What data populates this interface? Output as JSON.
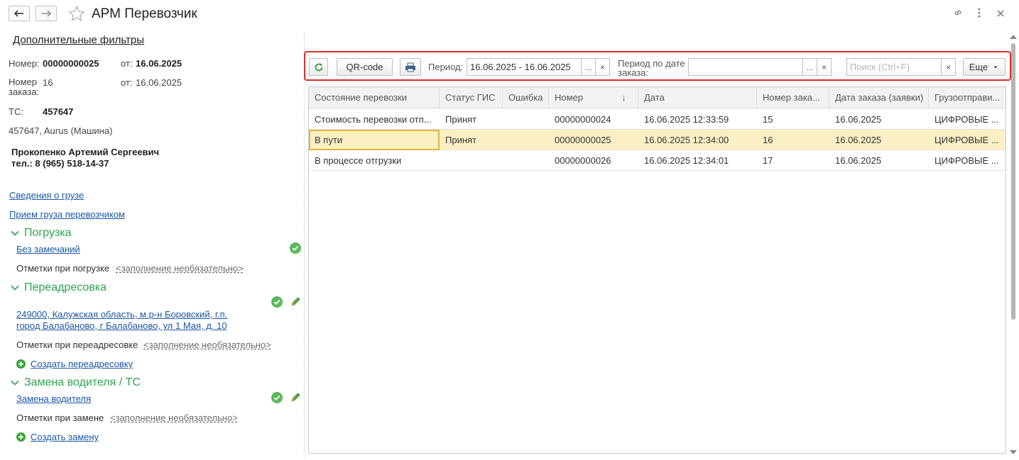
{
  "window": {
    "title": "АРМ Перевозчик",
    "back_icon": "arrow-left-icon",
    "forward_icon": "arrow-right-icon",
    "favorite_icon": "star-icon",
    "link_icon": "link-icon",
    "menu_icon": "more-vert-icon",
    "close_icon": "close-icon"
  },
  "left": {
    "extra_filters": "Дополнительные фильтры",
    "number_label": "Номер:",
    "number_value": "00000000025",
    "from_label": "от:",
    "from_value": "16.06.2025",
    "order_label": "Номер заказа:",
    "order_value": "16",
    "order_from_label": "от:",
    "order_from_value": "16.06.2025",
    "ts_label": "ТС:",
    "ts_value": "457647",
    "vehicle": "457647, Aurus (Машина)",
    "driver_name": "Прокопенко Артемий Сергеевич",
    "driver_phone": "тел.: 8 (965) 518-14-37",
    "cargo_info_link": "Сведения о грузе",
    "cargo_accept_link": "Прием груза перевозчиком",
    "loading": {
      "header": "Погрузка",
      "status_link": "Без замечаний",
      "notes_label": "Отметки при погрузке",
      "notes_hint": "<заполнение необязательно>"
    },
    "readdress": {
      "header": "Переадресовка",
      "address_line1": "249000, Калужская область, м.р-н Боровский, г.п.",
      "address_line2": "город Балабаново, г Балабаново, ул 1 Мая, д. 10",
      "notes_label": "Отметки при переадресовке",
      "notes_hint": "<заполнение необязательно>",
      "create_link": "Создать переадресовку"
    },
    "driver_change": {
      "header": "Замена водителя / ТС",
      "status_link": "Замена водителя",
      "notes_label": "Отметки при замене",
      "notes_hint": "<заполнение необязательно>",
      "create_link": "Создать замену"
    }
  },
  "toolbar": {
    "refresh_icon": "refresh-icon",
    "qr_label": "QR-code",
    "print_icon": "printer-icon",
    "period_label": "Период:",
    "period_value": "16.06.2025 - 16.06.2025",
    "period_dots": "...",
    "period_clear": "×",
    "order_period_label_1": "Период по дате",
    "order_period_label_2": "заказа:",
    "order_period_value": "",
    "order_period_dots": "...",
    "order_period_clear": "×",
    "search_placeholder": "Поиск (Ctrl+F)",
    "search_clear": "×",
    "more_label": "Еще",
    "more_icon": "dropdown-arrow-icon"
  },
  "table": {
    "columns": [
      "Состояние перевозки",
      "Статус ГИС",
      "Ошибка",
      "Номер",
      "Дата",
      "Номер зака...",
      "Дата заказа (заявки)",
      "Грузоотправи..."
    ],
    "sort_icon": "↓",
    "rows": [
      [
        "Стоимость перевозки отп...",
        "Принят",
        "",
        "00000000024",
        "16.06.2025 12:33:59",
        "15",
        "16.06.2025",
        "ЦИФРОВЫЕ ..."
      ],
      [
        "В пути",
        "Принят",
        "",
        "00000000025",
        "16.06.2025 12:34:00",
        "16",
        "16.06.2025",
        "ЦИФРОВЫЕ ..."
      ],
      [
        "В процессе отгрузки",
        "",
        "",
        "00000000026",
        "16.06.2025 12:34:01",
        "17",
        "16.06.2025",
        "ЦИФРОВЫЕ ..."
      ]
    ],
    "selected_row": 1
  },
  "colors": {
    "accent_green": "#2ea44f",
    "link_blue": "#1a57a6",
    "highlight_red": "#d9302b",
    "selection_yellow": "#fbf0c4"
  }
}
